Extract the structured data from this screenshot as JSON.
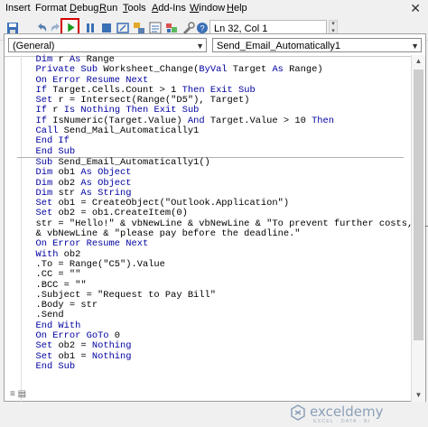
{
  "menu": {
    "items": [
      {
        "label": "Insert",
        "accel": ""
      },
      {
        "label": "Format",
        "accel": ""
      },
      {
        "label": "Debug",
        "accel": "D"
      },
      {
        "label": "Run",
        "accel": "R"
      },
      {
        "label": "Tools",
        "accel": "T"
      },
      {
        "label": "Add-Ins",
        "accel": "A"
      },
      {
        "label": "Window",
        "accel": "W"
      },
      {
        "label": "Help",
        "accel": "H"
      }
    ]
  },
  "toolbar": {
    "position": "Ln 32, Col 1"
  },
  "combos": {
    "object": "(General)",
    "procedure": "Send_Email_Automatically1"
  },
  "code": {
    "lines_top": [
      [
        {
          "t": "  "
        },
        {
          "k": "Dim"
        },
        {
          "t": " r "
        },
        {
          "k": "As"
        },
        {
          "t": " Range"
        }
      ],
      [
        {
          "t": "  "
        },
        {
          "k": "Private"
        },
        {
          "t": " "
        },
        {
          "k": "Sub"
        },
        {
          "t": " Worksheet_Change("
        },
        {
          "k": "ByVal"
        },
        {
          "t": " Target "
        },
        {
          "k": "As"
        },
        {
          "t": " Range)"
        }
      ],
      [
        {
          "t": "  "
        },
        {
          "k": "On Error Resume Next"
        }
      ],
      [
        {
          "t": "  "
        },
        {
          "k": "If"
        },
        {
          "t": " Target.Cells.Count > 1 "
        },
        {
          "k": "Then"
        },
        {
          "t": " "
        },
        {
          "k": "Exit Sub"
        }
      ],
      [
        {
          "t": "  "
        },
        {
          "k": "Set"
        },
        {
          "t": " r = Intersect(Range(\"D5\"), Target)"
        }
      ],
      [
        {
          "t": "  "
        },
        {
          "k": "If"
        },
        {
          "t": " r "
        },
        {
          "k": "Is"
        },
        {
          "t": " "
        },
        {
          "k": "Nothing"
        },
        {
          "t": " "
        },
        {
          "k": "Then"
        },
        {
          "t": " "
        },
        {
          "k": "Exit Sub"
        }
      ],
      [
        {
          "t": "  "
        },
        {
          "k": "If"
        },
        {
          "t": " IsNumeric(Target.Value) "
        },
        {
          "k": "And"
        },
        {
          "t": " Target.Value > 10 "
        },
        {
          "k": "Then"
        }
      ],
      [
        {
          "t": "  "
        },
        {
          "k": "Call"
        },
        {
          "t": " Send_Mail_Automatically1"
        }
      ],
      [
        {
          "t": "  "
        },
        {
          "k": "End If"
        }
      ],
      [
        {
          "t": "  "
        },
        {
          "k": "End Sub"
        }
      ]
    ],
    "lines_bottom": [
      [
        {
          "t": "  "
        },
        {
          "k": "Sub"
        },
        {
          "t": " Send_Email_Automatically1()"
        }
      ],
      [
        {
          "t": "  "
        },
        {
          "k": "Dim"
        },
        {
          "t": " ob1 "
        },
        {
          "k": "As Object"
        }
      ],
      [
        {
          "t": "  "
        },
        {
          "k": "Dim"
        },
        {
          "t": " ob2 "
        },
        {
          "k": "As Object"
        }
      ],
      [
        {
          "t": "  "
        },
        {
          "k": "Dim"
        },
        {
          "t": " str "
        },
        {
          "k": "As String"
        }
      ],
      [
        {
          "t": "  "
        },
        {
          "k": "Set"
        },
        {
          "t": " ob1 = CreateObject(\"Outlook.Application\")"
        }
      ],
      [
        {
          "t": "  "
        },
        {
          "k": "Set"
        },
        {
          "t": " ob2 = ob1.CreateItem(0)"
        }
      ],
      [
        {
          "t": "  str = \"Hello!\" & vbNewLine & vbNewLine & \"To prevent further costs,\" _"
        }
      ],
      [
        {
          "t": "  & vbNewLine & \"please pay before the deadline.\""
        }
      ],
      [
        {
          "t": "  "
        },
        {
          "k": "On Error Resume Next"
        }
      ],
      [
        {
          "t": "  "
        },
        {
          "k": "With"
        },
        {
          "t": " ob2"
        }
      ],
      [
        {
          "t": "  .To = Range(\"C5\").Value"
        }
      ],
      [
        {
          "t": "  .CC = \"\""
        }
      ],
      [
        {
          "t": "  .BCC = \"\""
        }
      ],
      [
        {
          "t": "  .Subject = \"Request to Pay Bill\""
        }
      ],
      [
        {
          "t": "  .Body = str"
        }
      ],
      [
        {
          "t": "  .Send"
        }
      ],
      [
        {
          "t": "  "
        },
        {
          "k": "End With"
        }
      ],
      [
        {
          "t": "  "
        },
        {
          "k": "On Error GoTo"
        },
        {
          "t": " 0"
        }
      ],
      [
        {
          "t": "  "
        },
        {
          "k": "Set"
        },
        {
          "t": " ob2 = "
        },
        {
          "k": "Nothing"
        }
      ],
      [
        {
          "t": "  "
        },
        {
          "k": "Set"
        },
        {
          "t": " ob1 = "
        },
        {
          "k": "Nothing"
        }
      ],
      [
        {
          "t": "  "
        },
        {
          "k": "End Sub"
        }
      ]
    ]
  },
  "watermark": {
    "name": "exceldemy",
    "tagline": "EXCEL · DATA · BI"
  },
  "colors": {
    "keyword": "#0000a0",
    "run_highlight": "#d40000",
    "run_arrow": "#1a9b1a"
  }
}
